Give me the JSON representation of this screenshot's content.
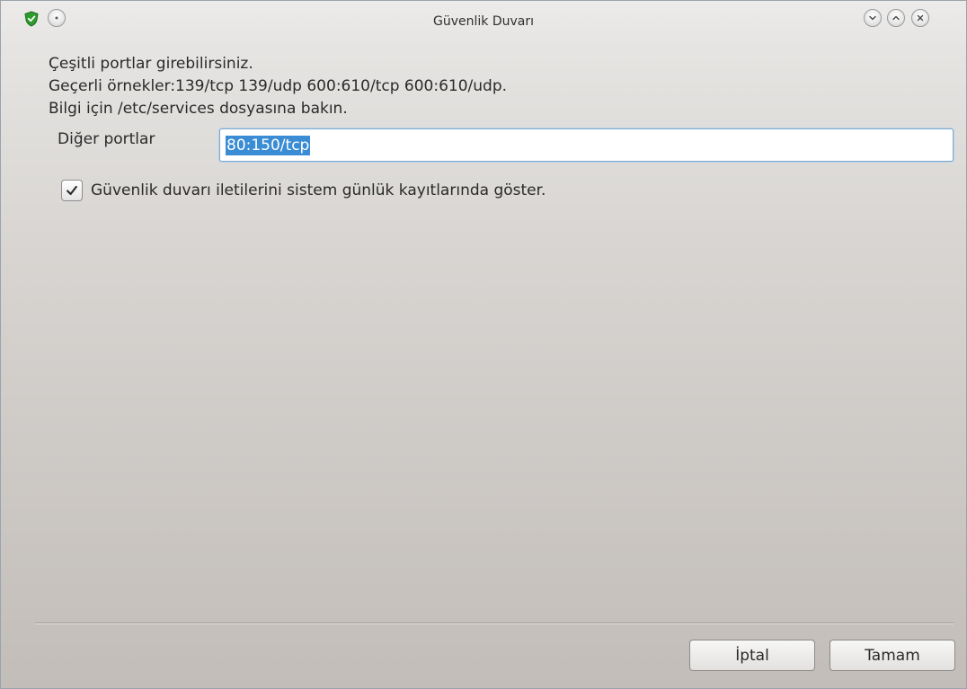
{
  "window": {
    "title": "Güvenlik Duvarı"
  },
  "titlebar": {
    "app_icon": "shield-check-icon",
    "menu_icon": "dot-circle-icon",
    "buttons": [
      "minimize-icon",
      "maximize-icon",
      "close-icon"
    ]
  },
  "info": {
    "line1": "Çeşitli portlar girebilirsiniz.",
    "line2": "Geçerli örnekler:139/tcp 139/udp 600:610/tcp 600:610/udp.",
    "line3": "Bilgi için /etc/services dosyasına bakın."
  },
  "ports": {
    "label": "Diğer portlar",
    "value": "80:150/tcp"
  },
  "log_option": {
    "checked": true,
    "label": "Güvenlik duvarı iletilerini sistem günlük kayıtlarında göster."
  },
  "buttons": {
    "cancel": "İptal",
    "ok": "Tamam"
  },
  "colors": {
    "selection": "#3a8cd4",
    "shield": "#2e9b2e",
    "input_border": "#7ea9cf"
  }
}
